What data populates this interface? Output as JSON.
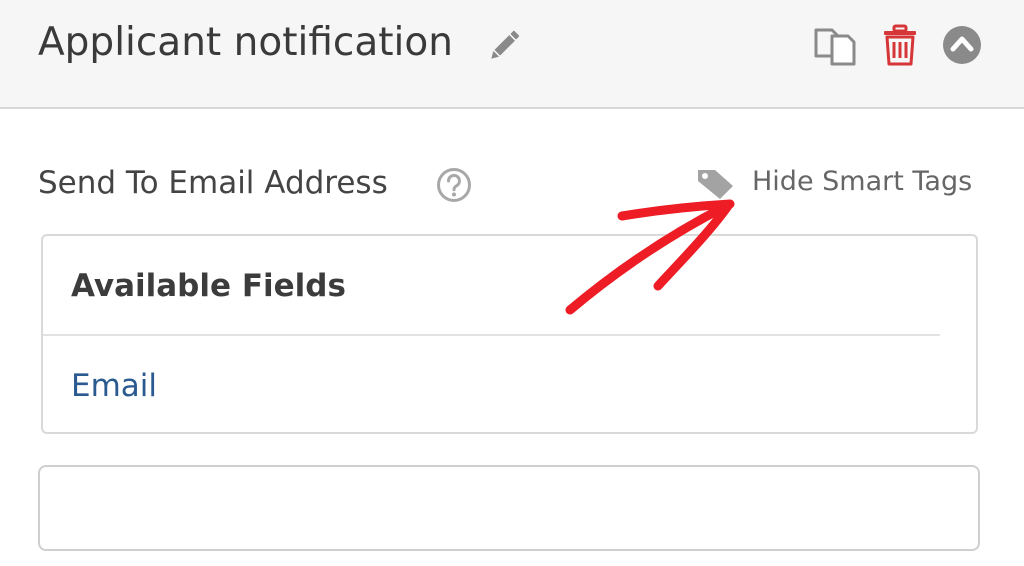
{
  "header": {
    "title": "Applicant notification",
    "icons": {
      "edit": "pencil-icon",
      "duplicate": "duplicate-icon",
      "delete": "trash-icon",
      "collapse": "chevron-up-circle-icon"
    }
  },
  "field": {
    "label": "Send To Email Address",
    "help_icon": "question-circle-icon",
    "smart_tags_toggle": {
      "icon": "tag-icon",
      "label": "Hide Smart Tags"
    },
    "smart_tags_panel": {
      "heading": "Available Fields",
      "items": [
        "Email"
      ]
    },
    "input_value": ""
  },
  "annotation": {
    "arrow_icon": "red-arrow-icon"
  },
  "colors": {
    "header_bg": "#f6f6f6",
    "title_text": "#3a3a3a",
    "icon_gray": "#8a8a8a",
    "delete_red": "#d63638",
    "link_blue": "#2a5a8f",
    "annotation_red": "#ee1c24"
  }
}
